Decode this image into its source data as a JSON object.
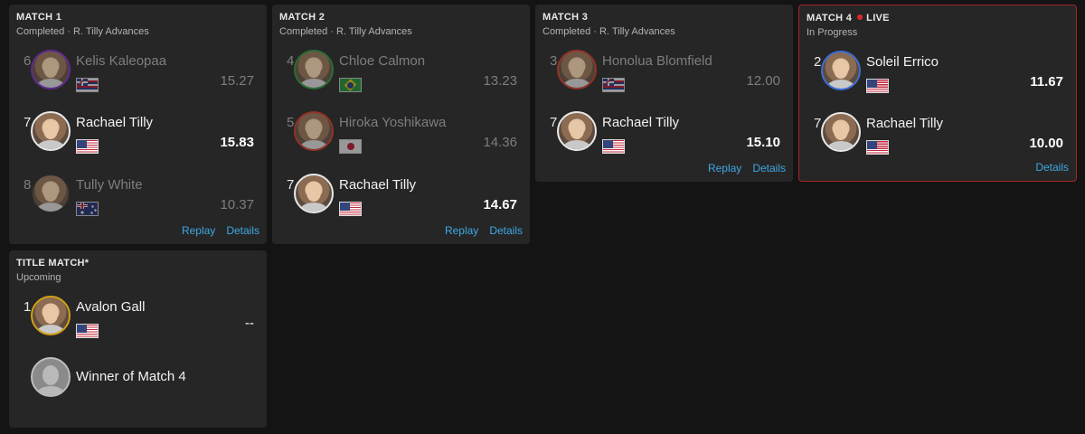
{
  "colors": {
    "background": "#141414",
    "card": "#262626",
    "link": "#3ea8e5",
    "live_red": "#e1262b",
    "live_border": "#a3262c"
  },
  "matches": [
    {
      "title": "MATCH 1",
      "status": "Completed · R. Tilly Advances",
      "links": [
        "Replay",
        "Details"
      ],
      "athletes": [
        {
          "seed": "6",
          "name": "Kelis Kaleopaa",
          "flag": "hawaii-flag-icon",
          "score": "15.27",
          "avatar_ring": "#7b2cbf",
          "state": "eliminated"
        },
        {
          "seed": "7",
          "name": "Rachael Tilly",
          "flag": "usa-flag-icon",
          "score": "15.83",
          "avatar_ring": "#e8e8e8",
          "state": "winner"
        },
        {
          "seed": "8",
          "name": "Tully White",
          "flag": "australia-flag-icon",
          "score": "10.37",
          "avatar_ring": "#2a2a2a",
          "state": "eliminated"
        }
      ]
    },
    {
      "title": "MATCH 2",
      "status": "Completed · R. Tilly Advances",
      "links": [
        "Replay",
        "Details"
      ],
      "athletes": [
        {
          "seed": "4",
          "name": "Chloe Calmon",
          "flag": "brazil-flag-icon",
          "score": "13.23",
          "avatar_ring": "#2e8b3a",
          "state": "eliminated"
        },
        {
          "seed": "5",
          "name": "Hiroka Yoshikawa",
          "flag": "japan-flag-icon",
          "score": "14.36",
          "avatar_ring": "#c0392b",
          "state": "eliminated"
        },
        {
          "seed": "7",
          "name": "Rachael Tilly",
          "flag": "usa-flag-icon",
          "score": "14.67",
          "avatar_ring": "#e8e8e8",
          "state": "winner"
        }
      ]
    },
    {
      "title": "MATCH 3",
      "status": "Completed · R. Tilly Advances",
      "links": [
        "Replay",
        "Details"
      ],
      "athletes": [
        {
          "seed": "3",
          "name": "Honolua Blomfield",
          "flag": "hawaii-flag-icon",
          "score": "12.00",
          "avatar_ring": "#c0392b",
          "state": "eliminated"
        },
        {
          "seed": "7",
          "name": "Rachael Tilly",
          "flag": "usa-flag-icon",
          "score": "15.10",
          "avatar_ring": "#e8e8e8",
          "state": "winner"
        }
      ]
    },
    {
      "title": "MATCH 4",
      "live_label": "LIVE",
      "status": "In Progress",
      "links": [
        "Details"
      ],
      "athletes": [
        {
          "seed": "2",
          "name": "Soleil Errico",
          "flag": "usa-flag-icon",
          "score": "11.67",
          "avatar_ring": "#3a6fd8",
          "state": "winner"
        },
        {
          "seed": "7",
          "name": "Rachael Tilly",
          "flag": "usa-flag-icon",
          "score": "10.00",
          "avatar_ring": "#e8e8e8",
          "state": "active"
        }
      ]
    },
    {
      "title": "TITLE MATCH*",
      "status": "Upcoming",
      "links": [],
      "athletes": [
        {
          "seed": "1",
          "name": "Avalon Gall",
          "flag": "usa-flag-icon",
          "score": "--",
          "avatar_ring": "#d4a017",
          "state": "active"
        },
        {
          "seed": "",
          "name": "Winner of Match 4",
          "flag": "",
          "score": "",
          "avatar_ring": "#bdbdbd",
          "state": "placeholder"
        }
      ]
    }
  ]
}
